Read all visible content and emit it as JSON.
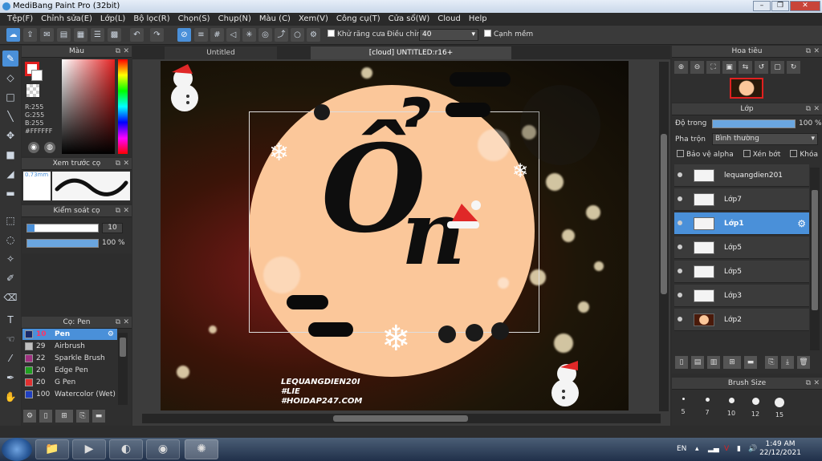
{
  "window": {
    "title": "MediBang Paint Pro (32bit)",
    "buttons": [
      "–",
      "❐",
      "✕"
    ]
  },
  "menu": [
    "Tệp(F)",
    "Chỉnh sửa(E)",
    "Lớp(L)",
    "Bộ lọc(R)",
    "Chọn(S)",
    "Chụp(N)",
    "Màu (C)",
    "Xem(V)",
    "Công cụ(T)",
    "Cửa sổ(W)",
    "Cloud",
    "Help"
  ],
  "toolbar": {
    "antialias_label": "Khử răng cưa",
    "adjust_label": "Điều chỉnh",
    "adjust_value": "40",
    "sharp_label": "Cạnh mềm"
  },
  "canvas_tabs": [
    "Untitled",
    "[cloud] UNTITLED:r16+"
  ],
  "color_panel": {
    "title": "Màu",
    "r": "R:255",
    "g": "G:255",
    "b": "B:255",
    "hex": "#FFFFFF",
    "primary_color": "#e02020",
    "secondary_color": "#ffffff"
  },
  "brush_preview": {
    "title": "Xem trước cọ",
    "size": "0.73mm"
  },
  "brush_control": {
    "title": "Kiểm soát cọ",
    "size_value": "10",
    "opacity_value": "100 %",
    "size_fraction": 0.1,
    "opacity_fraction": 1.0
  },
  "brush_list": {
    "title": "Cọ: Pen",
    "items": [
      {
        "size": "10",
        "name": "Pen",
        "color": "#1a2a6a",
        "active": true
      },
      {
        "size": "29",
        "name": "Airbrush",
        "color": "#c0c0c0"
      },
      {
        "size": "22",
        "name": "Sparkle Brush",
        "color": "#a03080"
      },
      {
        "size": "20",
        "name": "Edge Pen",
        "color": "#20a020"
      },
      {
        "size": "20",
        "name": "G Pen",
        "color": "#e03030"
      },
      {
        "size": "100",
        "name": "Watercolor (Wet)",
        "color": "#2040c0"
      }
    ]
  },
  "navigator": {
    "title": "Hoa tiêu"
  },
  "layer_panel": {
    "title": "Lớp",
    "opacity_label": "Độ trong",
    "opacity_value": "100 %",
    "opacity_fraction": 1.0,
    "blend_label": "Pha trộn",
    "blend_value": "Bình thường",
    "protect_alpha": "Bảo vệ alpha",
    "clipping": "Xén bớt",
    "lock": "Khóa",
    "layers": [
      "lequangdien201",
      "Lớp7",
      "Lớp1",
      "Lớp5",
      "Lớp5",
      "Lớp3",
      "Lớp2"
    ],
    "active_index": 2
  },
  "brush_size": {
    "title": "Brush Size",
    "sizes": [
      "5",
      "7",
      "10",
      "12",
      "15"
    ]
  },
  "artwork": {
    "big_glyph_1": "Ổ",
    "big_glyph_2": "n",
    "watermark_1": "LEQUANGDIEN20I",
    "watermark_2": "#LIE",
    "watermark_3": "#HOIDAP247.COM",
    "circle_color": "#fbc79a"
  },
  "taskbar": {
    "lang": "EN",
    "time": "1:49 AM",
    "date": "22/12/2021"
  }
}
